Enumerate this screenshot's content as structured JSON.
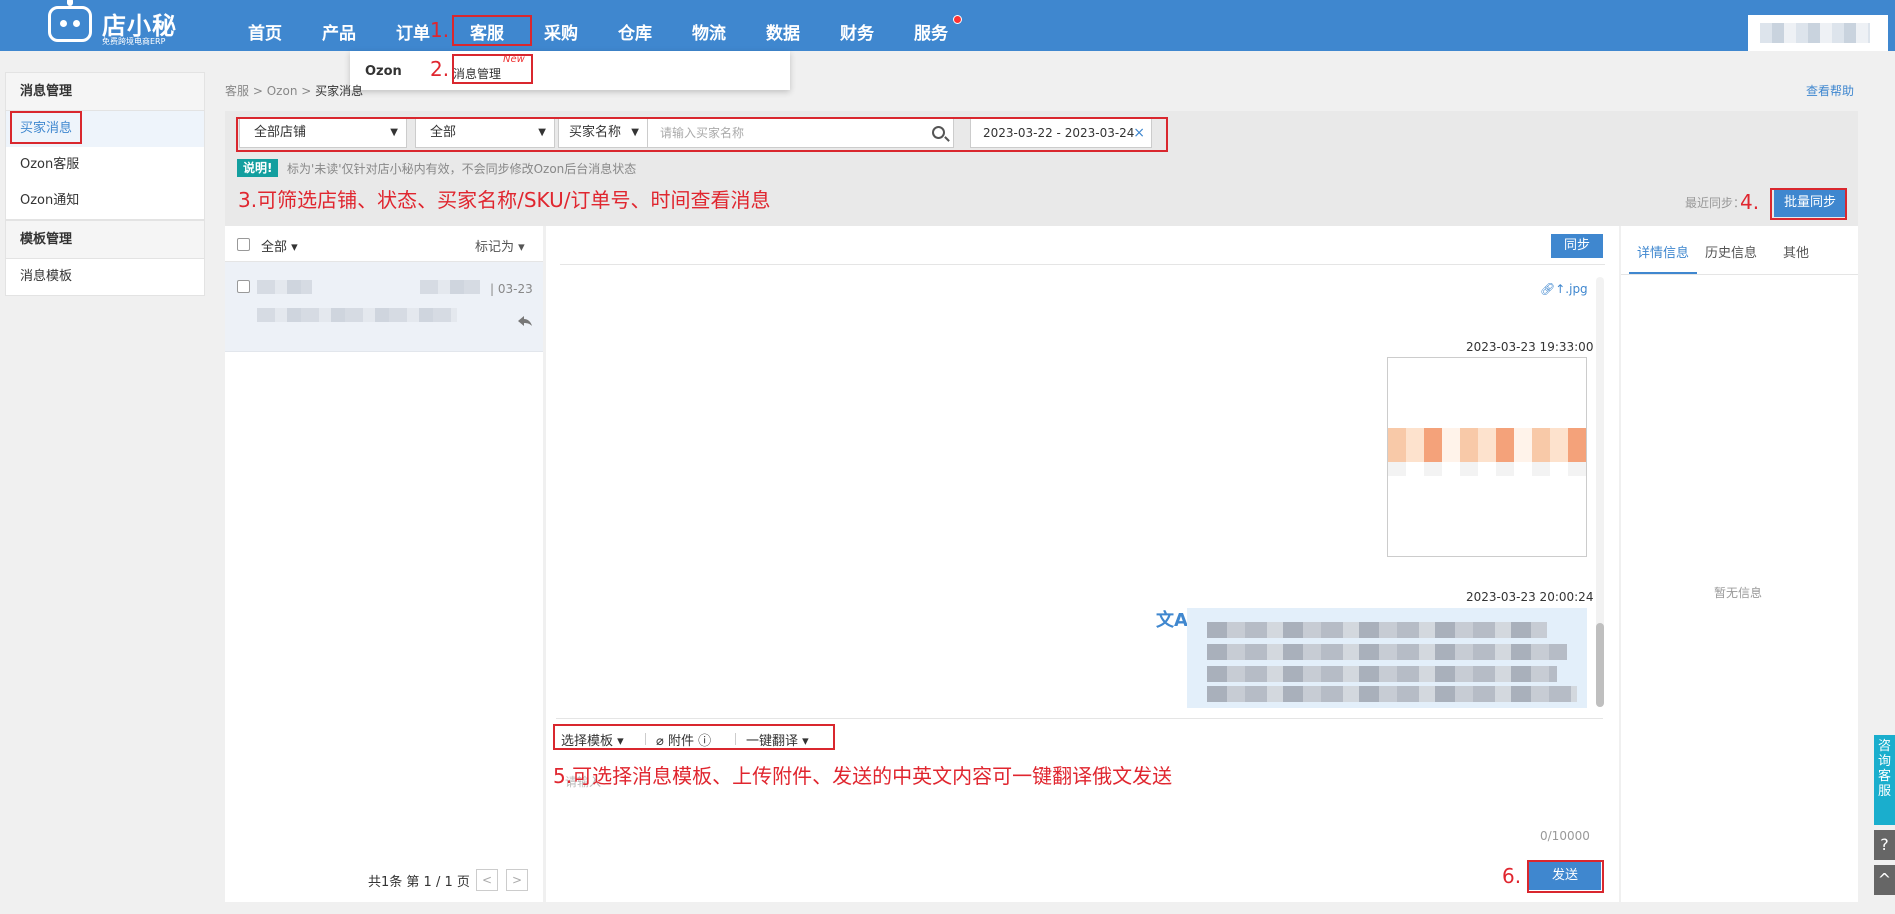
{
  "nav": {
    "logo_name": "店小秘",
    "logo_sub": "免费跨境电商ERP",
    "items": [
      "首页",
      "产品",
      "订单",
      "客服",
      "采购",
      "仓库",
      "物流",
      "数据",
      "财务",
      "服务"
    ]
  },
  "dropdown": {
    "platform": "Ozon",
    "item": "消息管理",
    "badge": "New"
  },
  "annotations": {
    "a1": "1.",
    "a2": "2.",
    "a3": "3.可筛选店铺、状态、买家名称/SKU/订单号、时间查看消息",
    "a4": "4.",
    "a5": "5.可选择消息模板、上传附件、发送的中英文内容可一键翻译俄文发送",
    "a6": "6."
  },
  "sidebar": {
    "group1_title": "消息管理",
    "group1_items": [
      "买家消息",
      "Ozon客服",
      "Ozon通知"
    ],
    "group2_title": "模板管理",
    "group2_items": [
      "消息模板"
    ]
  },
  "breadcrumb": {
    "level1": "客服",
    "level2": "Ozon",
    "current": "买家消息",
    "sep": ">"
  },
  "help_link": "查看帮助",
  "filters": {
    "shop": "全部店铺",
    "status": "全部",
    "search_type": "买家名称",
    "search_placeholder": "请输入买家名称",
    "date_range": "2023-03-22 - 2023-03-24",
    "clear": "×"
  },
  "note": {
    "badge": "说明!",
    "text": "标为'未读'仅针对店小秘内有效，不会同步修改Ozon后台消息状态"
  },
  "sync": {
    "last_sync_label": "最近同步：",
    "batch_sync_button": "批量同步",
    "sync_button": "同步"
  },
  "list": {
    "select_all": "全部",
    "mark_as": "标记为",
    "rows": [
      {
        "date": "| 03-23"
      }
    ],
    "pager": "共1条  第 1 / 1 页",
    "prev": "<",
    "next": ">"
  },
  "conversation": {
    "attachment": "↑.jpg",
    "messages": [
      {
        "time": "2023-03-23 19:33:00",
        "type": "image"
      },
      {
        "time": "2023-03-23 20:00:24",
        "type": "text"
      }
    ],
    "toolbar": {
      "template": "选择模板",
      "attachment": "附件",
      "translate": "一键翻译"
    },
    "placeholder": "请输入",
    "counter": "0/10000",
    "send_button": "发送"
  },
  "details": {
    "tabs": [
      "详情信息",
      "历史信息",
      "其他"
    ],
    "empty": "暂无信息"
  },
  "float": {
    "cs": "咨询客服",
    "help": "?",
    "top": "^"
  },
  "colors": {
    "nav_bg": "#3f87cf",
    "accent": "#3f87cf",
    "annotation_red": "#e0262f",
    "note_badge": "#139f9f"
  }
}
